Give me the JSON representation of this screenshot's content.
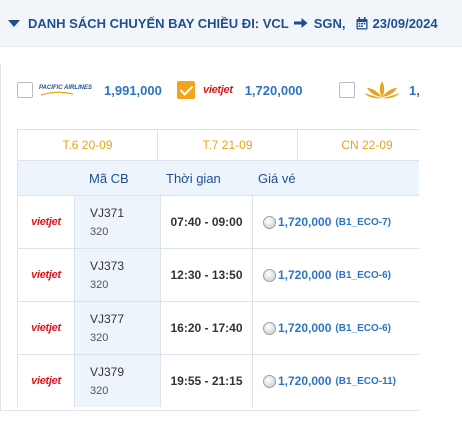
{
  "header": {
    "title": "DANH SÁCH CHUYẾN BAY CHIỀU ĐI: VCL",
    "destination": "SGN,",
    "date": "23/09/2024"
  },
  "airline_filters": [
    {
      "airline": "Pacific Airlines",
      "logo_text": "PACIFIC AIRLINES",
      "price": "1,991,000",
      "checked": false
    },
    {
      "airline": "Vietjet",
      "logo_text": "vietjet",
      "price": "1,720,000",
      "checked": true
    },
    {
      "airline": "Vietnam Airlines",
      "logo_text": "",
      "price": "1,",
      "checked": false
    }
  ],
  "dates": [
    "T.6 20-09",
    "T.7 21-09",
    "CN 22-09"
  ],
  "table": {
    "columns": [
      "Mã CB",
      "Thời gian",
      "Giá vé"
    ],
    "rows": [
      {
        "logo_text": "vietjet",
        "code": "VJ371",
        "aircraft": "320",
        "time": "07:40 - 09:00",
        "price": "1,720,000",
        "fare_class": "(B1_ECO-7)"
      },
      {
        "logo_text": "vietjet",
        "code": "VJ373",
        "aircraft": "320",
        "time": "12:30 - 13:50",
        "price": "1,720,000",
        "fare_class": "(B1_ECO-6)"
      },
      {
        "logo_text": "vietjet",
        "code": "VJ377",
        "aircraft": "320",
        "time": "16:20 - 17:40",
        "price": "1,720,000",
        "fare_class": "(B1_ECO-6)"
      },
      {
        "logo_text": "vietjet",
        "code": "VJ379",
        "aircraft": "320",
        "time": "19:55 - 21:15",
        "price": "1,720,000",
        "fare_class": "(B1_ECO-11)"
      }
    ]
  },
  "colors": {
    "primary": "#1d4f91",
    "price": "#2d74c4",
    "date_accent": "#e8a41b",
    "checkbox_checked": "#f2a51c",
    "vietjet_red": "#d71920",
    "header_bg": "#f2f6fb",
    "column_bg": "#eef4fb"
  },
  "icons": {
    "collapse": "caret-down-icon",
    "route": "arrow-right-icon",
    "date": "calendar-icon"
  }
}
